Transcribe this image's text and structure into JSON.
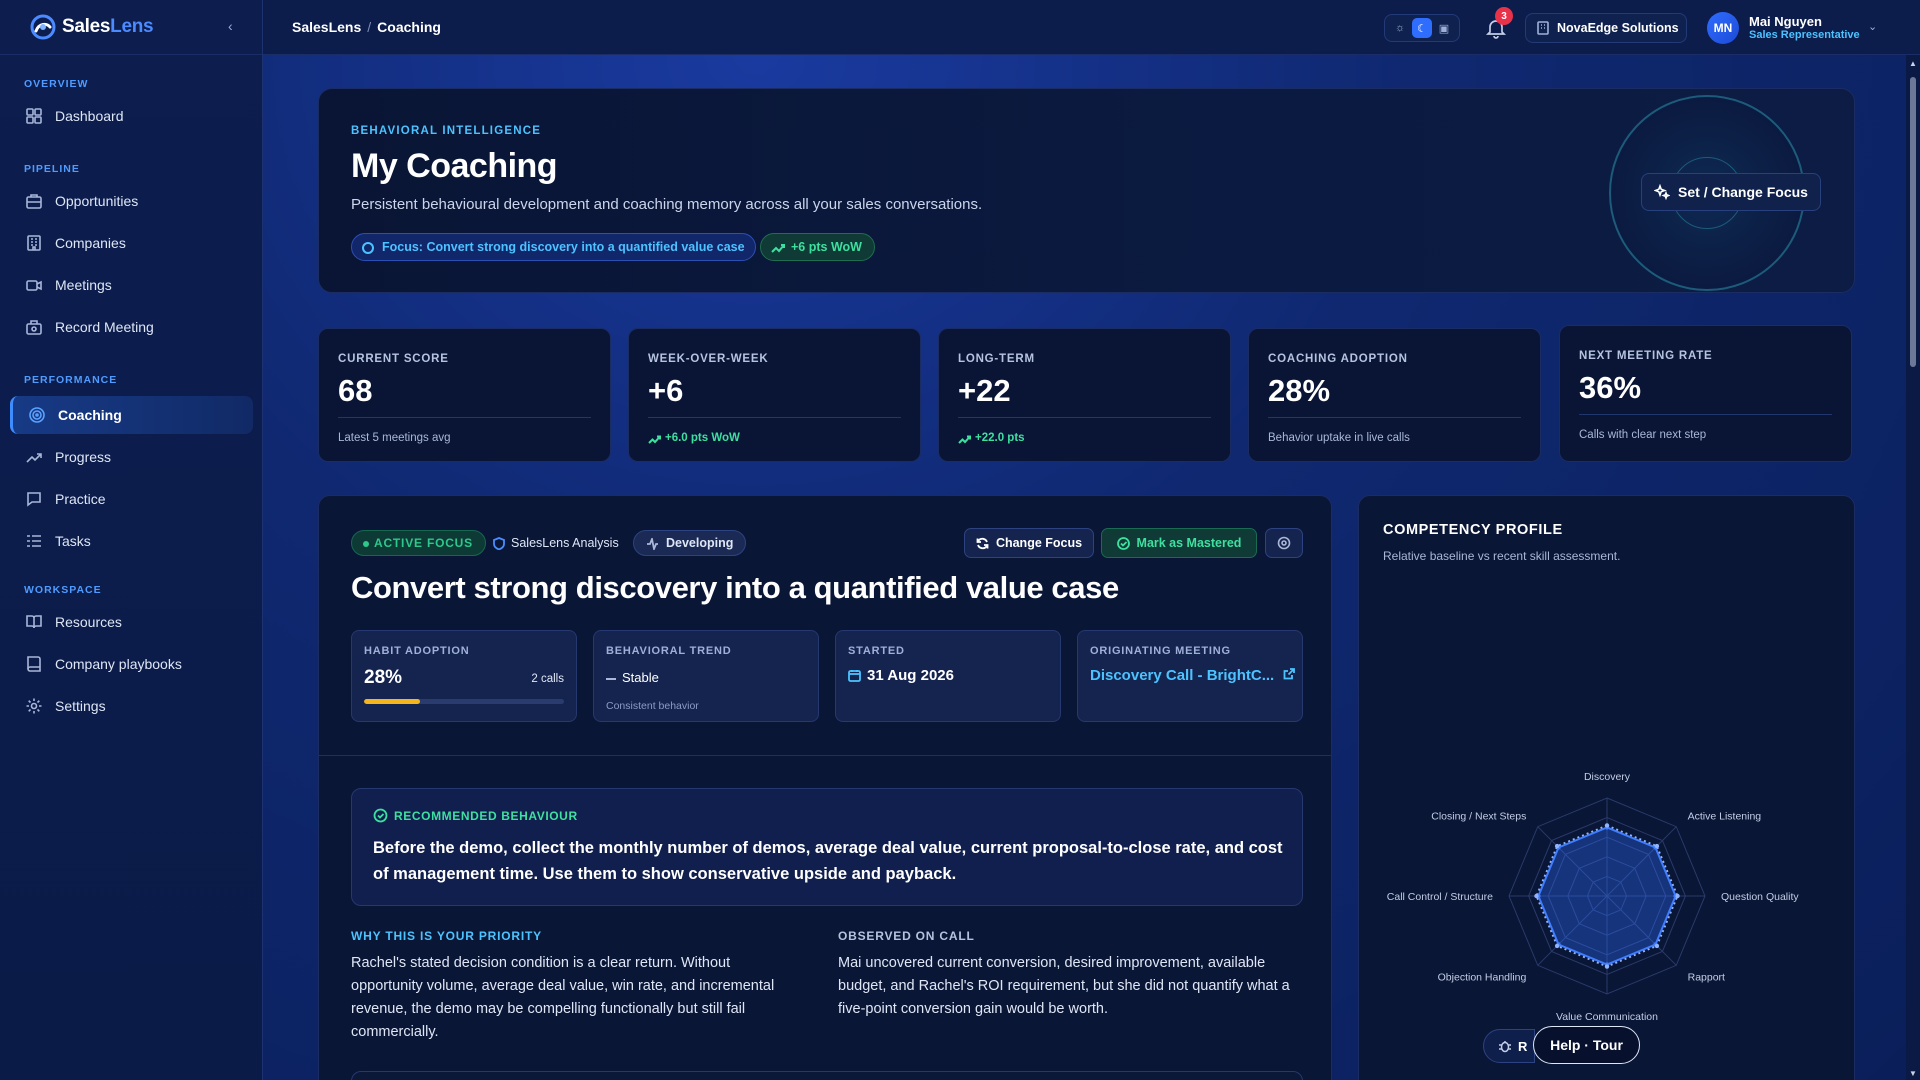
{
  "app": {
    "brand_part1": "Sales",
    "brand_part2": "Lens"
  },
  "breadcrumb": {
    "root": "SalesLens",
    "separator": "/",
    "current": "Coaching"
  },
  "header": {
    "notifications_count": "3",
    "organization": "NovaEdge Solutions",
    "user": {
      "initials": "MN",
      "name": "Mai Nguyen",
      "role": "Sales Representative"
    }
  },
  "sidebar": {
    "sections": [
      {
        "title": "OVERVIEW",
        "items": [
          {
            "label": "Dashboard",
            "icon": "grid-icon"
          }
        ]
      },
      {
        "title": "PIPELINE",
        "items": [
          {
            "label": "Opportunities",
            "icon": "briefcase-icon"
          },
          {
            "label": "Companies",
            "icon": "building-icon"
          },
          {
            "label": "Meetings",
            "icon": "video-icon"
          },
          {
            "label": "Record Meeting",
            "icon": "recorder-icon"
          }
        ]
      },
      {
        "title": "PERFORMANCE",
        "items": [
          {
            "label": "Coaching",
            "icon": "target-icon",
            "active": true
          },
          {
            "label": "Progress",
            "icon": "trend-up-icon"
          },
          {
            "label": "Practice",
            "icon": "chat-icon"
          },
          {
            "label": "Tasks",
            "icon": "list-icon"
          }
        ]
      },
      {
        "title": "WORKSPACE",
        "items": [
          {
            "label": "Resources",
            "icon": "book-icon"
          },
          {
            "label": "Company playbooks",
            "icon": "book-open-icon"
          },
          {
            "label": "Settings",
            "icon": "gear-icon"
          }
        ]
      }
    ]
  },
  "hero": {
    "eyebrow": "BEHAVIORAL INTELLIGENCE",
    "title": "My Coaching",
    "subtitle": "Persistent behavioural development and coaching memory across all your sales conversations.",
    "focus_pill": "Focus: Convert strong discovery into a quantified value case",
    "wow_pill": "+6 pts WoW",
    "set_focus_button": "Set / Change Focus"
  },
  "kpis": [
    {
      "label": "CURRENT SCORE",
      "value": "68",
      "foot": "Latest 5 meetings avg",
      "trend": false
    },
    {
      "label": "WEEK-OVER-WEEK",
      "value": "+6",
      "foot": "+6.0 pts WoW",
      "trend": true
    },
    {
      "label": "LONG-TERM",
      "value": "+22",
      "foot": "+22.0 pts",
      "trend": true
    },
    {
      "label": "COACHING ADOPTION",
      "value": "28%",
      "foot": "Behavior uptake in live calls",
      "trend": false
    },
    {
      "label": "NEXT MEETING RATE",
      "value": "36%",
      "foot": "Calls with clear next step",
      "trend": false
    }
  ],
  "focus": {
    "active_badge": "ACTIVE FOCUS",
    "source_badge": "SalesLens Analysis",
    "level_badge": "Developing",
    "change_button": "Change Focus",
    "mastered_button": "Mark as Mastered",
    "title": "Convert strong discovery into a quantified value case",
    "stats": {
      "habit": {
        "label": "HABIT ADOPTION",
        "value": "28%",
        "calls": "2 calls",
        "progress": 0.28
      },
      "trend": {
        "label": "BEHAVIORAL TREND",
        "value": "Stable",
        "note": "Consistent behavior"
      },
      "started": {
        "label": "STARTED",
        "value": "31 Aug 2026"
      },
      "meeting": {
        "label": "ORIGINATING MEETING",
        "value": "Discovery Call - BrightC..."
      }
    },
    "recommended": {
      "label": "RECOMMENDED BEHAVIOUR",
      "text": "Before the demo, collect the monthly number of demos, average deal value, current proposal-to-close rate, and cost of management time. Use them to show conservative upside and payback."
    },
    "why": {
      "label": "WHY THIS IS YOUR PRIORITY",
      "text": "Rachel's stated decision condition is a clear return. Without opportunity volume, average deal value, win rate, and incremental revenue, the demo may be compelling functionally but still fail commercially."
    },
    "observed": {
      "label": "OBSERVED ON CALL",
      "text": "Mai uncovered current conversion, desired improvement, available budget, and Rachel's ROI requirement, but she did not quantify what a five-point conversion gain would be worth."
    }
  },
  "competency": {
    "title": "COMPETENCY PROFILE",
    "subtitle": "Relative baseline vs recent skill assessment."
  },
  "chart_data": {
    "type": "radar",
    "categories": [
      "Discovery",
      "Active Listening",
      "Question Quality",
      "Rapport",
      "Value Communication",
      "Objection Handling",
      "Call Control / Structure",
      "Closing / Next Steps"
    ],
    "series": [
      {
        "values": [
          0.7,
          0.7,
          0.7,
          0.7,
          0.7,
          0.7,
          0.7,
          0.7
        ],
        "color": "#3f7dff",
        "style": "solid"
      },
      {
        "values": [
          0.72,
          0.72,
          0.72,
          0.72,
          0.72,
          0.72,
          0.72,
          0.72
        ],
        "color": "#8fb3ff",
        "style": "dotted"
      }
    ],
    "rlim": [
      0,
      1
    ],
    "grid": true
  },
  "floating": {
    "r_button": "R",
    "help_button": "Help · Tour"
  },
  "colors": {
    "accent": "#2f6dff",
    "success": "#3ee0a0",
    "info": "#4cc3ff",
    "warning": "#f5b51c",
    "danger": "#e8324a"
  }
}
